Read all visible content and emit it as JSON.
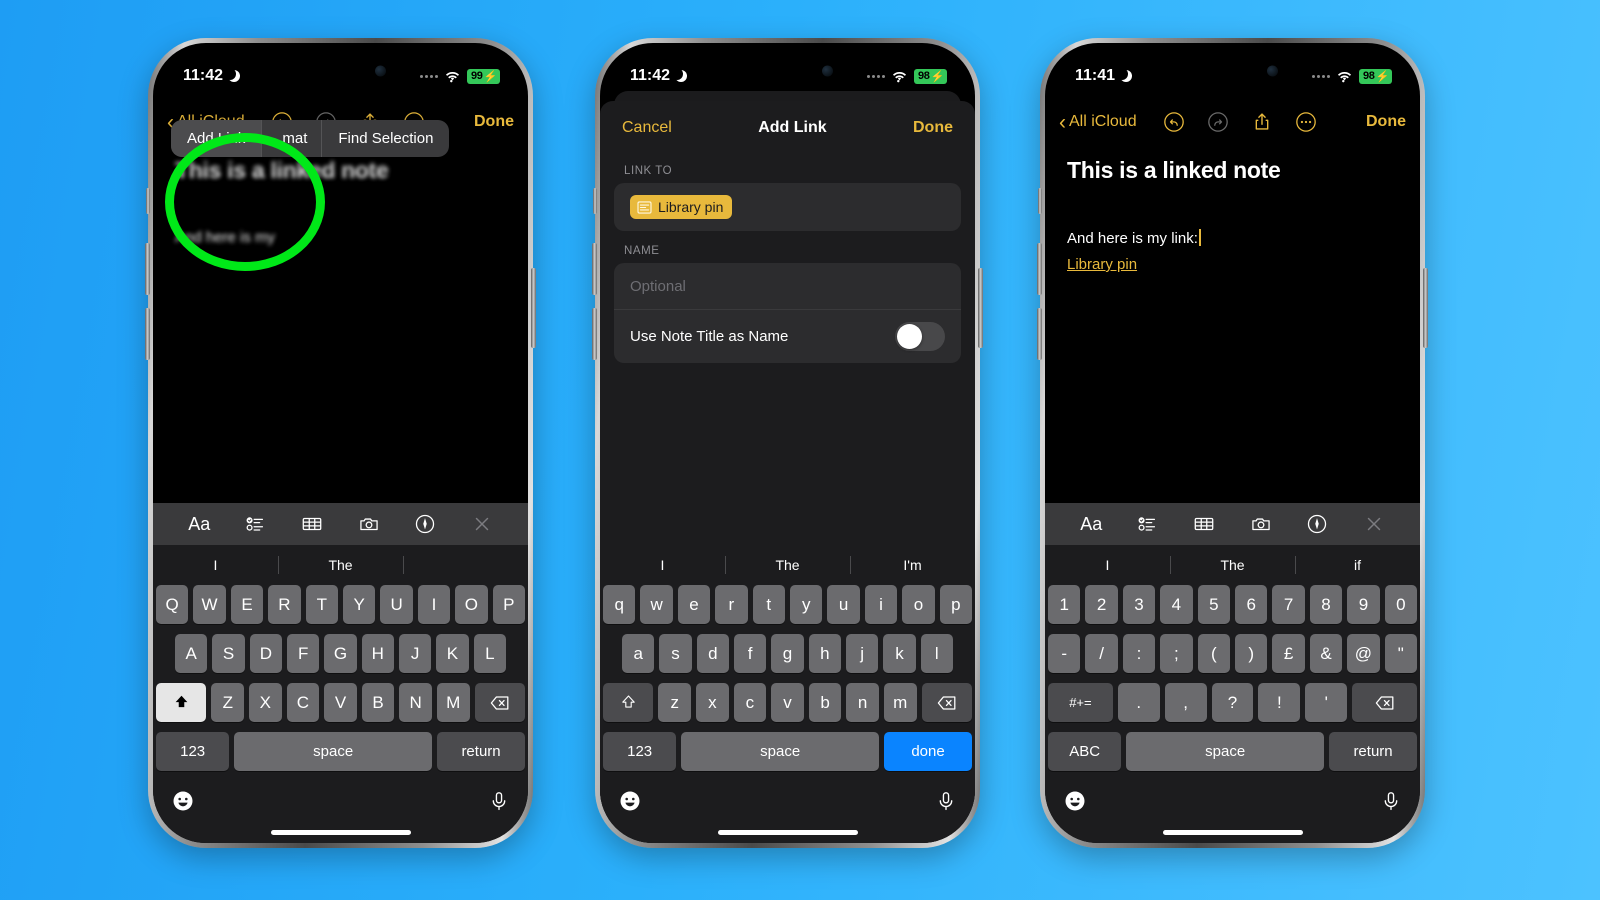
{
  "background_color": "#2bb0fb",
  "annotation": {
    "color": "#00e818",
    "shape": "circle",
    "target": "add-link-menu-item"
  },
  "phones": [
    {
      "id": "phone-1",
      "status": {
        "time": "11:42",
        "moon": "do-not-disturb-icon",
        "battery": "99",
        "charging": true,
        "wifi": "wifi-icon"
      },
      "navbar": {
        "back": "All iCloud",
        "undo": "undo-icon",
        "redo": "redo-icon",
        "share": "share-icon",
        "more": "more-icon",
        "done": "Done"
      },
      "note": {
        "title": "This is a linked note",
        "body": "And here is my"
      },
      "context_menu": {
        "items": [
          "Add Link",
          "mat",
          "Find Selection"
        ],
        "highlighted": "Add Link"
      },
      "keyboard": {
        "tools": [
          "Aa",
          "checklist-icon",
          "table-icon",
          "camera-icon",
          "markup-icon",
          "close-icon"
        ],
        "predictions": [
          "I",
          "The",
          ""
        ],
        "row1": [
          "Q",
          "W",
          "E",
          "R",
          "T",
          "Y",
          "U",
          "I",
          "O",
          "P"
        ],
        "row2": [
          "A",
          "S",
          "D",
          "F",
          "G",
          "H",
          "J",
          "K",
          "L"
        ],
        "row3": [
          "Z",
          "X",
          "C",
          "V",
          "B",
          "N",
          "M"
        ],
        "shift": "shift-icon",
        "shift_active": true,
        "backspace": "backspace-icon",
        "numbers_key": "123",
        "space_key": "space",
        "action_key": "return",
        "action_style": "dark",
        "emoji": "emoji-icon",
        "mic": "microphone-icon"
      }
    },
    {
      "id": "phone-2",
      "status": {
        "time": "11:42",
        "moon": "do-not-disturb-icon",
        "battery": "98",
        "charging": true,
        "wifi": "wifi-icon"
      },
      "sheet": {
        "cancel": "Cancel",
        "title": "Add Link",
        "done": "Done",
        "link_to_label": "LINK TO",
        "link_chip": {
          "icon": "note-doc-icon",
          "label": "Library pin"
        },
        "name_label": "NAME",
        "name_placeholder": "Optional",
        "toggle_label": "Use Note Title as Name",
        "toggle_on": false
      },
      "keyboard": {
        "predictions": [
          "I",
          "The",
          "I'm"
        ],
        "row1": [
          "q",
          "w",
          "e",
          "r",
          "t",
          "y",
          "u",
          "i",
          "o",
          "p"
        ],
        "row2": [
          "a",
          "s",
          "d",
          "f",
          "g",
          "h",
          "j",
          "k",
          "l"
        ],
        "row3": [
          "z",
          "x",
          "c",
          "v",
          "b",
          "n",
          "m"
        ],
        "shift": "shift-icon",
        "shift_active": false,
        "backspace": "backspace-icon",
        "numbers_key": "123",
        "space_key": "space",
        "action_key": "done",
        "action_style": "blue",
        "emoji": "emoji-icon",
        "mic": "microphone-icon"
      }
    },
    {
      "id": "phone-3",
      "status": {
        "time": "11:41",
        "moon": "do-not-disturb-icon",
        "battery": "98",
        "charging": true,
        "wifi": "wifi-icon"
      },
      "navbar": {
        "back": "All iCloud",
        "undo": "undo-icon",
        "redo": "redo-icon",
        "share": "share-icon",
        "more": "more-icon",
        "done": "Done"
      },
      "note": {
        "title": "This is a linked note",
        "body": "And here is my link:",
        "link": "Library pin"
      },
      "keyboard": {
        "tools": [
          "Aa",
          "checklist-icon",
          "table-icon",
          "camera-icon",
          "markup-icon",
          "close-icon"
        ],
        "predictions": [
          "I",
          "The",
          "if"
        ],
        "row1": [
          "1",
          "2",
          "3",
          "4",
          "5",
          "6",
          "7",
          "8",
          "9",
          "0"
        ],
        "row2": [
          "-",
          "/",
          ":",
          ";",
          "(",
          ")",
          "£",
          "&",
          "@",
          "\""
        ],
        "row3": [
          "#+=",
          ".",
          ",",
          "?",
          "!",
          "'"
        ],
        "backspace": "backspace-icon",
        "letters_key": "ABC",
        "space_key": "space",
        "action_key": "return",
        "action_style": "dark",
        "emoji": "emoji-icon",
        "mic": "microphone-icon"
      }
    }
  ]
}
